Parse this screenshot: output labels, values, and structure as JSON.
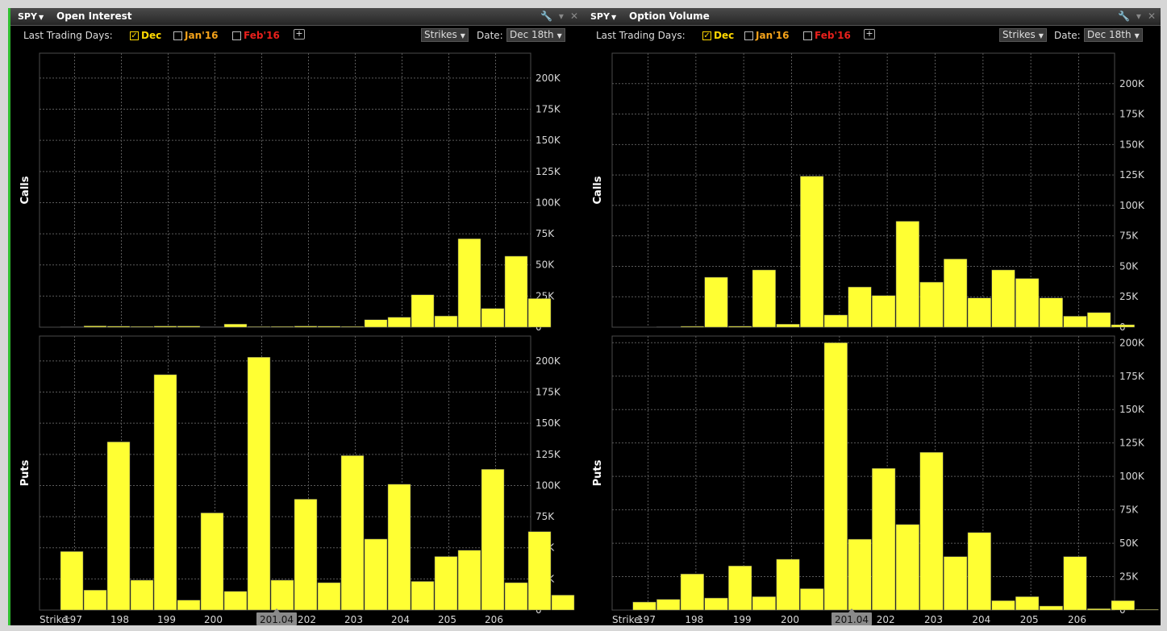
{
  "left": {
    "symbol": "SPY",
    "title": "Open Interest",
    "last_trading_days_label": "Last Trading Days:",
    "expiries": [
      {
        "label": "Dec",
        "checked": true,
        "color": "#ffd800"
      },
      {
        "label": "Jan'16",
        "checked": false,
        "color": "#f5a31a"
      },
      {
        "label": "Feb'16",
        "checked": false,
        "color": "#e8201c"
      }
    ],
    "plus_label": "+",
    "strikes_dropdown": "Strikes",
    "date_label": "Date:",
    "date_value": "Dec 18th",
    "strike_axis_label": "Strike:",
    "highlight_label": "201.04"
  },
  "right": {
    "symbol": "SPY",
    "title": "Option Volume",
    "last_trading_days_label": "Last Trading Days:",
    "expiries": [
      {
        "label": "Dec",
        "checked": true,
        "color": "#ffd800"
      },
      {
        "label": "Jan'16",
        "checked": false,
        "color": "#f5a31a"
      },
      {
        "label": "Feb'16",
        "checked": false,
        "color": "#e8201c"
      }
    ],
    "plus_label": "+",
    "strikes_dropdown": "Strikes",
    "date_label": "Date:",
    "date_value": "Dec 18th",
    "strike_axis_label": "Strike:",
    "highlight_label": "201.04"
  },
  "chart_data": [
    {
      "type": "bar",
      "title": "Open Interest",
      "ylabel": "Calls",
      "xlabel": "Strike:",
      "ylim": [
        0,
        220000
      ],
      "yticks": [
        0,
        25000,
        50000,
        75000,
        100000,
        125000,
        150000,
        175000,
        200000
      ],
      "ytick_labels": [
        "0",
        "25K",
        "50K",
        "75K",
        "100K",
        "125K",
        "150K",
        "175K",
        "200K"
      ],
      "x": [
        196.5,
        197,
        197.5,
        198,
        198.5,
        199,
        199.5,
        200,
        200.5,
        201,
        201.5,
        202,
        202.5,
        203,
        203.5,
        204,
        204.5,
        205,
        205.5,
        206,
        206.5
      ],
      "xtick_labels": [
        "197",
        "198",
        "199",
        "200",
        "202",
        "203",
        "204",
        "205",
        "206"
      ],
      "values": [
        300,
        1000,
        800,
        600,
        900,
        900,
        300,
        2500,
        500,
        600,
        900,
        800,
        600,
        6000,
        8000,
        26000,
        9000,
        71000,
        15000,
        57000,
        23000
      ],
      "color": "#ffff33"
    },
    {
      "type": "bar",
      "title": "Open Interest",
      "ylabel": "Puts",
      "xlabel": "Strike:",
      "ylim": [
        0,
        220000
      ],
      "yticks": [
        0,
        25000,
        50000,
        75000,
        100000,
        125000,
        150000,
        175000,
        200000
      ],
      "ytick_labels": [
        "0",
        "25K",
        "50K",
        "75K",
        "100K",
        "125K",
        "150K",
        "175K",
        "200K"
      ],
      "x": [
        196.5,
        197,
        197.5,
        198,
        198.5,
        199,
        199.5,
        200,
        200.5,
        201,
        201.5,
        202,
        202.5,
        203,
        203.5,
        204,
        204.5,
        205,
        205.5,
        206,
        206.5
      ],
      "xtick_labels": [
        "197",
        "198",
        "199",
        "200",
        "202",
        "203",
        "204",
        "205",
        "206"
      ],
      "values": [
        47000,
        16000,
        135000,
        24000,
        189000,
        8000,
        78000,
        15000,
        203000,
        24000,
        89000,
        22000,
        124000,
        57000,
        101000,
        23000,
        43000,
        48000,
        113000,
        22000,
        63000,
        12000
      ],
      "color": "#ffff33"
    },
    {
      "type": "bar",
      "title": "Option Volume",
      "ylabel": "Calls",
      "xlabel": "Strike:",
      "ylim": [
        0,
        225000
      ],
      "yticks": [
        0,
        25000,
        50000,
        75000,
        100000,
        125000,
        150000,
        175000,
        200000
      ],
      "ytick_labels": [
        "0",
        "25K",
        "50K",
        "75K",
        "100K",
        "125K",
        "150K",
        "175K",
        "200K"
      ],
      "x": [
        196.5,
        197,
        197.5,
        198,
        198.5,
        199,
        199.5,
        200,
        200.5,
        201,
        201.5,
        202,
        202.5,
        203,
        203.5,
        204,
        204.5,
        205,
        205.5,
        206,
        206.5
      ],
      "xtick_labels": [
        "197",
        "198",
        "199",
        "200",
        "202",
        "203",
        "204",
        "205",
        "206"
      ],
      "values": [
        0,
        300,
        700,
        41000,
        800,
        47000,
        2500,
        124000,
        10000,
        33000,
        26000,
        87000,
        37000,
        56000,
        24000,
        47000,
        40000,
        24000,
        9000,
        12000,
        2000
      ],
      "color": "#ffff33"
    },
    {
      "type": "bar",
      "title": "Option Volume",
      "ylabel": "Puts",
      "xlabel": "Strike:",
      "ylim": [
        0,
        205000
      ],
      "yticks": [
        0,
        25000,
        50000,
        75000,
        100000,
        125000,
        150000,
        175000,
        200000
      ],
      "ytick_labels": [
        "0",
        "25K",
        "50K",
        "75K",
        "100K",
        "125K",
        "150K",
        "175K",
        "200K"
      ],
      "x": [
        196.5,
        197,
        197.5,
        198,
        198.5,
        199,
        199.5,
        200,
        200.5,
        201,
        201.5,
        202,
        202.5,
        203,
        203.5,
        204,
        204.5,
        205,
        205.5,
        206,
        206.5
      ],
      "xtick_labels": [
        "197",
        "198",
        "199",
        "200",
        "202",
        "203",
        "204",
        "205",
        "206"
      ],
      "values": [
        6000,
        8000,
        27000,
        9000,
        33000,
        10000,
        38000,
        16000,
        200000,
        53000,
        106000,
        64000,
        118000,
        40000,
        58000,
        7000,
        10000,
        3000,
        40000,
        1000,
        7000,
        500
      ],
      "color": "#ffff33"
    }
  ]
}
